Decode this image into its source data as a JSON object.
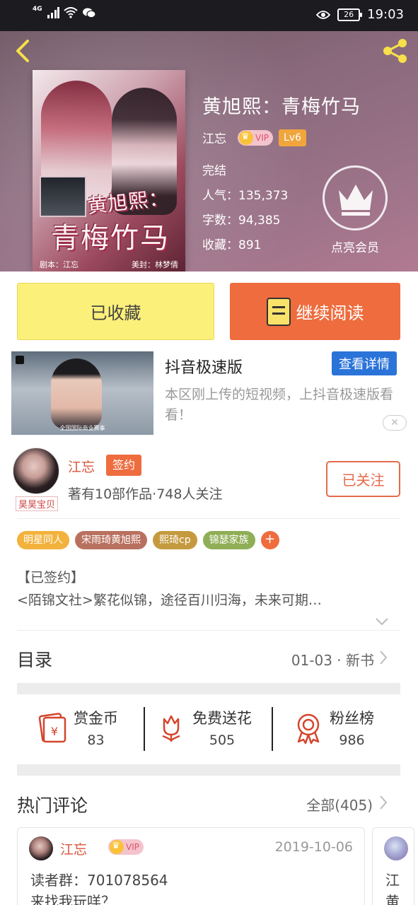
{
  "status_bar": {
    "network": "4G",
    "battery": "26",
    "time": "19:03"
  },
  "book": {
    "title": "黄旭熙：青梅竹马",
    "author": "江忘",
    "vip_label": "VIP",
    "level": "Lv6",
    "status": "完结",
    "popularity": "人气：135,373",
    "word_count": "字数：94,385",
    "favorites": "收藏：891",
    "vip_cta": "点亮会员",
    "cover": {
      "title_line1": "黄旭熙：",
      "title_line2": "青梅竹马",
      "credit_left": "剧本：江忘",
      "credit_right": "美封：林梦倩"
    }
  },
  "actions": {
    "collected_label": "已收藏",
    "continue_label": "继续阅读"
  },
  "ad": {
    "title": "抖音极速版",
    "detail_button": "查看详情",
    "description": "本区刚上传的短视频，上抖音极速版看看！",
    "thumb_caption": "全国国际商业赛事"
  },
  "author": {
    "name": "江忘",
    "signed_label": "签约",
    "meta": "著有10部作品·748人关注",
    "follow_label": "已关注",
    "avatar_tag": "昊昊宝贝"
  },
  "tags": [
    {
      "label": "明星同人",
      "color": "#f3b23c"
    },
    {
      "label": "宋雨琦黄旭熙",
      "color": "#b9715f"
    },
    {
      "label": "熙琦cp",
      "color": "#c59a3f"
    },
    {
      "label": "锦瑟家族",
      "color": "#8fae56"
    }
  ],
  "intro": {
    "line1": "【已签约】",
    "line2": "<陌锦文社>繁花似锦，途径百川归海，未来可期…"
  },
  "toc": {
    "label": "目录",
    "latest": "01-03 · 新书"
  },
  "stats": {
    "reward": {
      "name": "赏金币",
      "value": "83"
    },
    "flowers": {
      "name": "免费送花",
      "value": "505"
    },
    "fans": {
      "name": "粉丝榜",
      "value": "986"
    }
  },
  "comments": {
    "label": "热门评论",
    "all_label": "全部(405)",
    "items": [
      {
        "author": "江忘",
        "vip": "VIP",
        "date": "2019-10-06",
        "line1": "读者群：701078564",
        "line2": "来找我玩咩？"
      },
      {
        "author_partial": "江",
        "body_partial": "黄"
      }
    ]
  },
  "colors": {
    "accent_orange": "#ee6c3e",
    "collected_yellow": "#fbf07a",
    "ad_blue": "#2a73d9",
    "author_red": "#d9553a"
  }
}
